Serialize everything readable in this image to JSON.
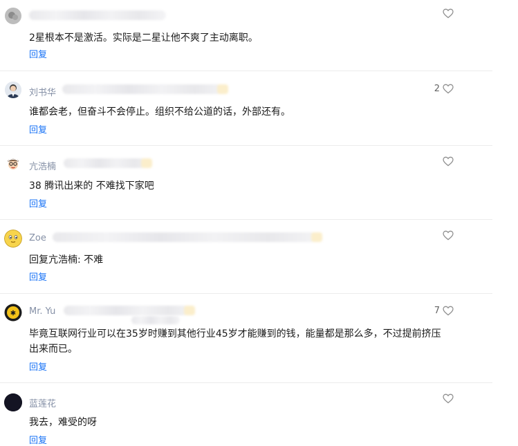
{
  "comments": [
    {
      "author": "",
      "text": "2星根本不是激活。实际是二星让他不爽了主动离职。",
      "reply": "回复",
      "likes": ""
    },
    {
      "author": "刘书华",
      "text": "谁都会老，但奋斗不会停止。组织不给公道的话，外部还有。",
      "reply": "回复",
      "likes": "2"
    },
    {
      "author": "亢浩楠",
      "text": "38 腾讯出来的 不难找下家吧",
      "reply": "回复",
      "likes": ""
    },
    {
      "author": "Zoe",
      "text": "回复亢浩楠: 不难",
      "reply": "回复",
      "likes": ""
    },
    {
      "author": "Mr. Yu",
      "text": "毕竟互联网行业可以在35岁时赚到其他行业45岁才能赚到的钱，能量都是那么多，不过提前挤压出来而已。",
      "reply": "回复",
      "likes": "7"
    },
    {
      "author": "蓝莲花",
      "text": "我去，难受的呀",
      "reply": "回复",
      "likes": ""
    }
  ],
  "icons": {
    "like": "heart-outline-icon"
  },
  "colors": {
    "link": "#1772f6",
    "author": "#8590a6"
  }
}
